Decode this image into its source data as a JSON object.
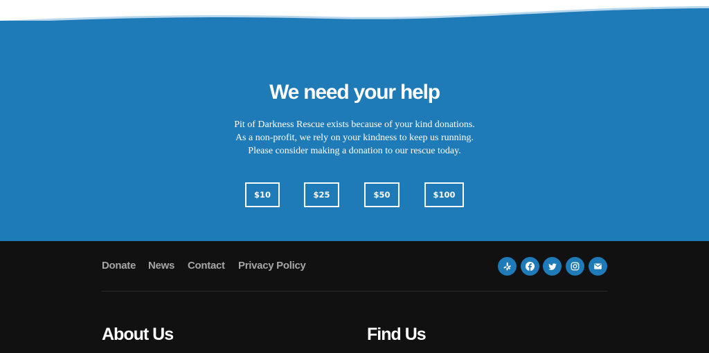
{
  "donation": {
    "title": "We need your help",
    "description": "Pit of Darkness Rescue exists because of your kind donations. As a non-profit, we rely on your kindness to keep us running. Please consider making a donation to our rescue today.",
    "amounts": [
      "$10",
      "$25",
      "$50",
      "$100"
    ],
    "band_color": "#1f7bb8"
  },
  "footer": {
    "nav": [
      "Donate",
      "News",
      "Contact",
      "Privacy Policy"
    ],
    "social_icons": [
      "yelp-icon",
      "facebook-icon",
      "twitter-icon",
      "instagram-icon",
      "mail-icon"
    ],
    "columns": [
      "About Us",
      "Find Us"
    ],
    "background_color": "#111111"
  }
}
